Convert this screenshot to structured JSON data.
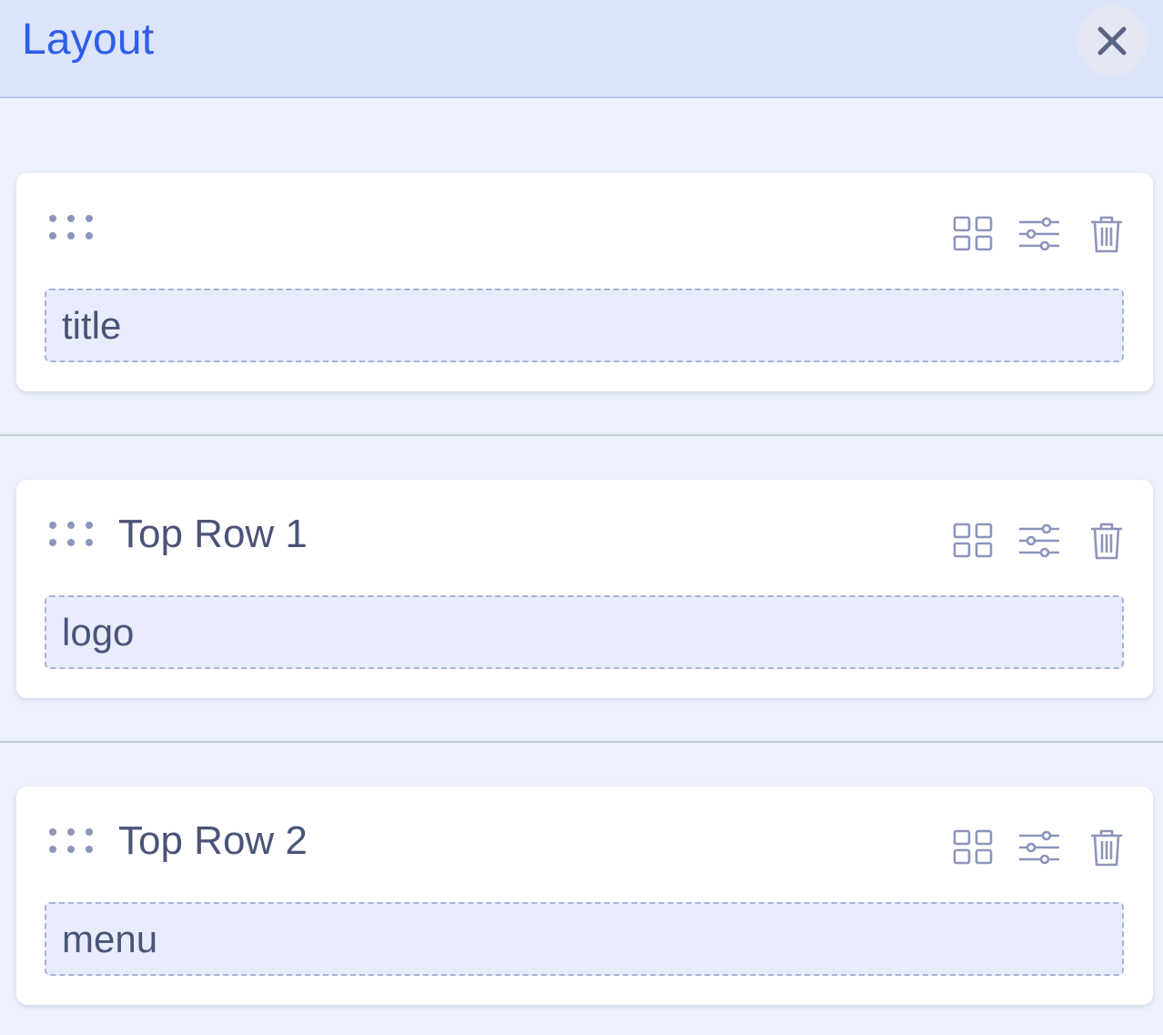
{
  "panel": {
    "title": "Layout",
    "close_icon": "close-icon",
    "colors": {
      "header_bg": "#dce4fb",
      "title": "#2f5ee8",
      "body_bg": "#edf1fb",
      "slot_bg": "#e9edfb",
      "icon": "#8c95bb"
    }
  },
  "rows": [
    {
      "title": "",
      "slot_label": "title"
    },
    {
      "title": "Top Row 1",
      "slot_label": "logo"
    },
    {
      "title": "Top Row 2",
      "slot_label": "menu"
    }
  ],
  "row_actions": {
    "icons": [
      "drag-handle-icon",
      "grid-icon",
      "sliders-icon",
      "trash-icon"
    ]
  }
}
